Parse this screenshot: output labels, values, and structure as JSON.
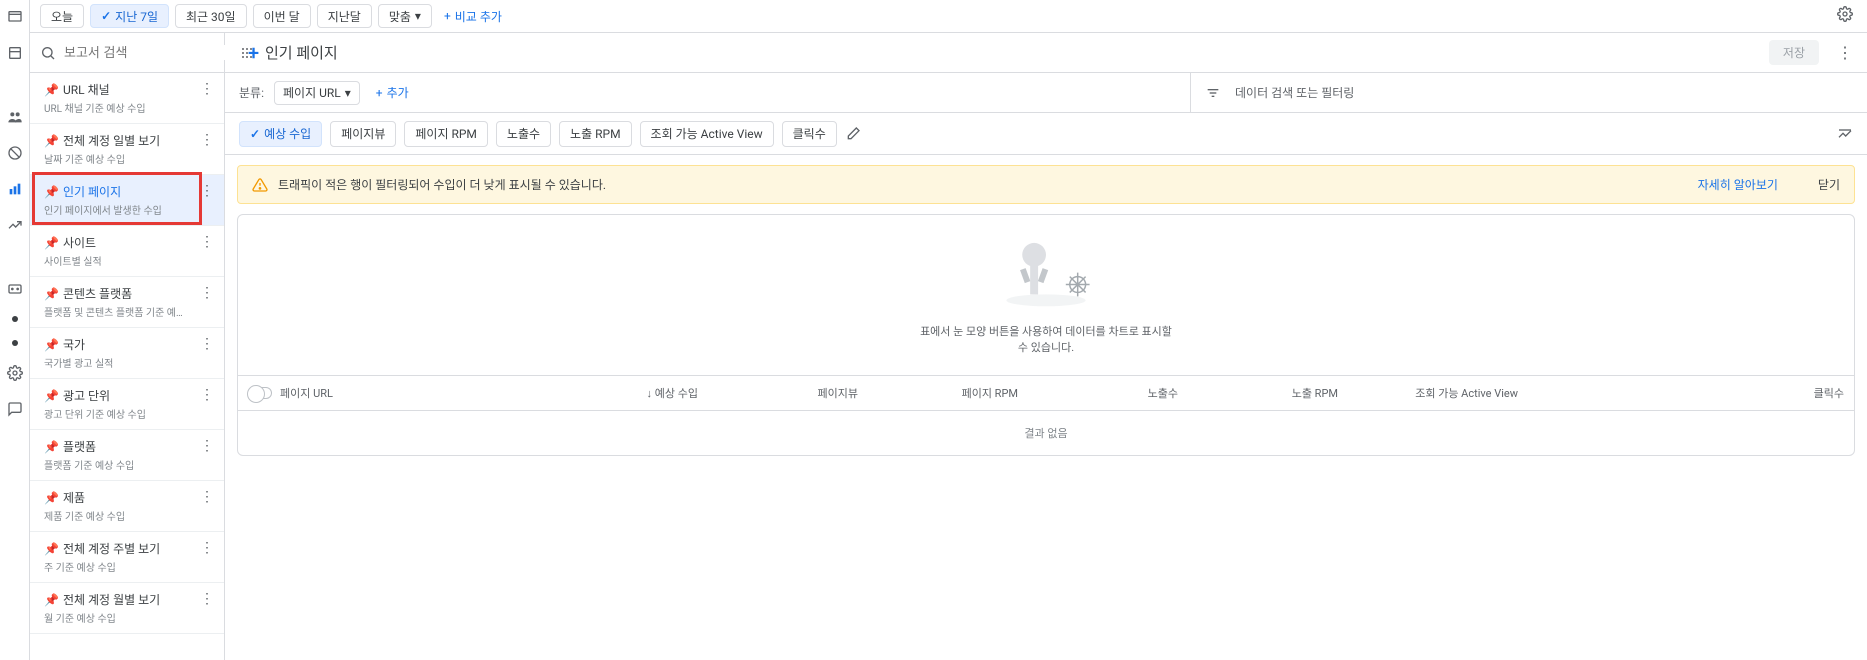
{
  "date_chips": {
    "today": "오늘",
    "last7": "지난 7일",
    "last30": "최근 30일",
    "this_month": "이번 달",
    "last_month": "지난달",
    "custom": "맞춤",
    "add_compare": "비교 추가"
  },
  "sidebar": {
    "search_placeholder": "보고서 검색",
    "items": [
      {
        "title": "URL 채널",
        "sub": "URL 채널 기준 예상 수입"
      },
      {
        "title": "전체 계정 일별 보기",
        "sub": "날짜 기준 예상 수입"
      },
      {
        "title": "인기 페이지",
        "sub": "인기 페이지에서 발생한 수입"
      },
      {
        "title": "사이트",
        "sub": "사이트별 실적"
      },
      {
        "title": "콘텐츠 플랫폼",
        "sub": "플랫폼 및 콘텐츠 플랫폼 기준 예…"
      },
      {
        "title": "국가",
        "sub": "국가별 광고 실적"
      },
      {
        "title": "광고 단위",
        "sub": "광고 단위 기준 예상 수입"
      },
      {
        "title": "플랫폼",
        "sub": "플랫폼 기준 예상 수입"
      },
      {
        "title": "제품",
        "sub": "제품 기준 예상 수입"
      },
      {
        "title": "전체 계정 주별 보기",
        "sub": "주 기준 예상 수입"
      },
      {
        "title": "전체 계정 월별 보기",
        "sub": "월 기준 예상 수입"
      }
    ]
  },
  "page": {
    "title": "인기 페이지",
    "save": "저장"
  },
  "filter": {
    "breakdown_label": "분류:",
    "breakdown_value": "페이지 URL",
    "add": "추가",
    "search_placeholder": "데이터 검색 또는 필터링"
  },
  "metrics": [
    "예상 수입",
    "페이지뷰",
    "페이지 RPM",
    "노출수",
    "노출 RPM",
    "조회 가능 Active View",
    "클릭수"
  ],
  "alert": {
    "text": "트래픽이 적은 행이 필터링되어 수입이 더 낮게 표시될 수 있습니다.",
    "learn_more": "자세히 알아보기",
    "close": "닫기"
  },
  "empty": {
    "caption": "표에서 눈 모양 버튼을 사용하여 데이터를 차트로 표시할 수 있습니다."
  },
  "table": {
    "cols": [
      "페이지 URL",
      "예상 수입",
      "페이지뷰",
      "페이지 RPM",
      "노출수",
      "노출 RPM",
      "조회 가능 Active View",
      "클릭수"
    ],
    "no_results": "결과 없음"
  }
}
